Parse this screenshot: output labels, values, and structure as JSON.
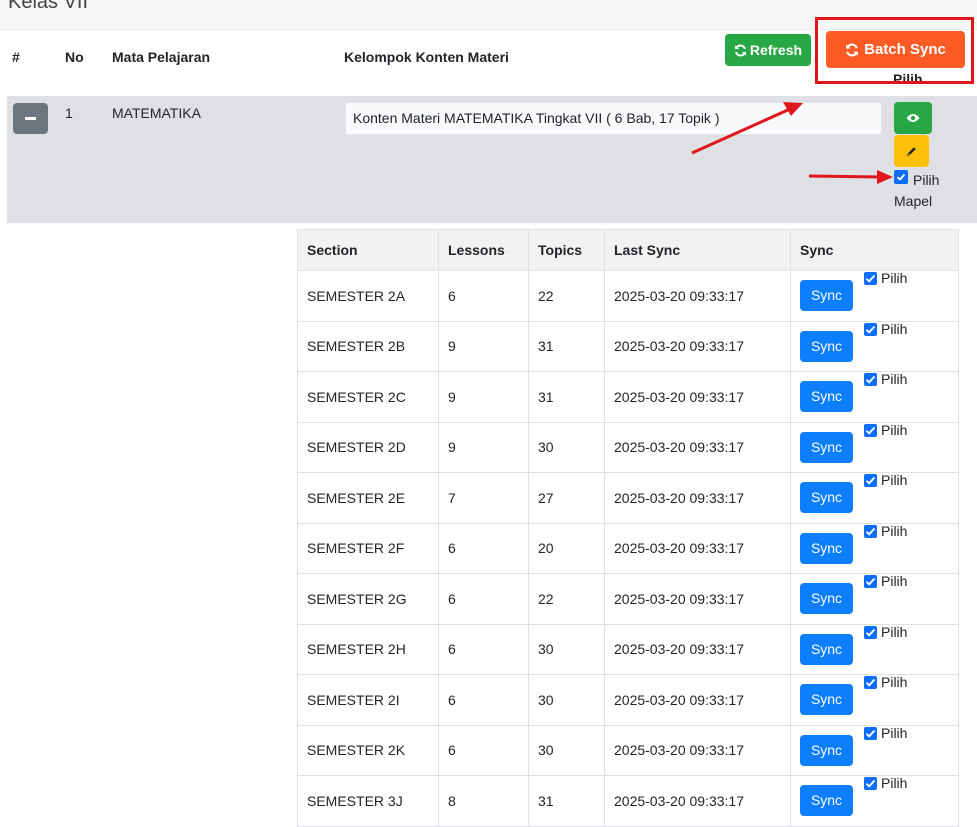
{
  "page": {
    "title": "Kelas VII"
  },
  "header": {
    "col_hash": "#",
    "col_no": "No",
    "col_mapel": "Mata Pelajaran",
    "col_konten": "Kelompok Konten Materi",
    "refresh_label": "Refresh",
    "batch_sync_label": "Batch Sync",
    "pilih_label": "Pilih"
  },
  "row": {
    "no": "1",
    "mapel": "MATEMATIKA",
    "konten_value": "Konten Materi MATEMATIKA Tingkat VII ( 6 Bab, 17 Topik )",
    "pilih_mapel_label": "Pilih Mapel"
  },
  "sections_table": {
    "headers": [
      "Section",
      "Lessons",
      "Topics",
      "Last Sync",
      "Sync"
    ],
    "sync_label": "Sync",
    "pilih_label": "Pilih",
    "rows": [
      {
        "section": "SEMESTER 2A",
        "lessons": "6",
        "topics": "22",
        "last_sync": "2025-03-20 09:33:17"
      },
      {
        "section": "SEMESTER 2B",
        "lessons": "9",
        "topics": "31",
        "last_sync": "2025-03-20 09:33:17"
      },
      {
        "section": "SEMESTER 2C",
        "lessons": "9",
        "topics": "31",
        "last_sync": "2025-03-20 09:33:17"
      },
      {
        "section": "SEMESTER 2D",
        "lessons": "9",
        "topics": "30",
        "last_sync": "2025-03-20 09:33:17"
      },
      {
        "section": "SEMESTER 2E",
        "lessons": "7",
        "topics": "27",
        "last_sync": "2025-03-20 09:33:17"
      },
      {
        "section": "SEMESTER 2F",
        "lessons": "6",
        "topics": "20",
        "last_sync": "2025-03-20 09:33:17"
      },
      {
        "section": "SEMESTER 2G",
        "lessons": "6",
        "topics": "22",
        "last_sync": "2025-03-20 09:33:17"
      },
      {
        "section": "SEMESTER 2H",
        "lessons": "6",
        "topics": "30",
        "last_sync": "2025-03-20 09:33:17"
      },
      {
        "section": "SEMESTER 2I",
        "lessons": "6",
        "topics": "30",
        "last_sync": "2025-03-20 09:33:17"
      },
      {
        "section": "SEMESTER 2K",
        "lessons": "6",
        "topics": "30",
        "last_sync": "2025-03-20 09:33:17"
      },
      {
        "section": "SEMESTER 3J",
        "lessons": "8",
        "topics": "31",
        "last_sync": "2025-03-20 09:33:17"
      }
    ]
  },
  "colors": {
    "refresh_green": "#28a745",
    "batch_orange": "#fd5b25",
    "highlight_red": "#e0161d",
    "sync_blue": "#0d7efe",
    "edit_yellow": "#ffc107"
  }
}
